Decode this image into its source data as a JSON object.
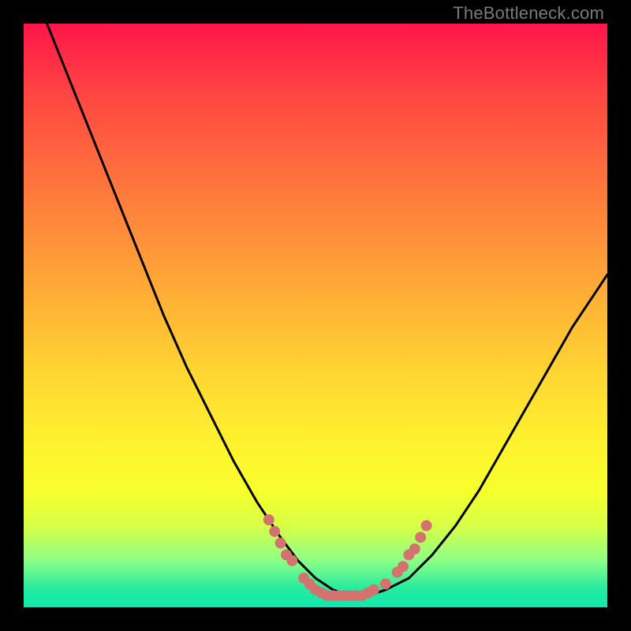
{
  "watermark": "TheBottleneck.com",
  "colors": {
    "frame": "#000000",
    "gradient_top": "#ff154a",
    "gradient_bottom": "#12e8b0",
    "curve": "#000000",
    "markers": "#d4726f"
  },
  "chart_data": {
    "type": "line",
    "title": "",
    "xlabel": "",
    "ylabel": "",
    "xlim": [
      0,
      100
    ],
    "ylim": [
      0,
      100
    ],
    "series": [
      {
        "name": "bottleneck-curve",
        "x": [
          4,
          8,
          12,
          16,
          20,
          24,
          28,
          32,
          36,
          40,
          44,
          47,
          50,
          53,
          56,
          59,
          62,
          66,
          70,
          74,
          78,
          82,
          86,
          90,
          94,
          98,
          100
        ],
        "y": [
          100,
          90,
          80,
          70,
          60,
          50,
          41,
          33,
          25,
          18,
          12,
          8,
          5,
          3,
          2,
          2,
          3,
          5,
          9,
          14,
          20,
          27,
          34,
          41,
          48,
          54,
          57
        ]
      }
    ],
    "markers": [
      {
        "x": 42,
        "y": 15
      },
      {
        "x": 43,
        "y": 13
      },
      {
        "x": 44,
        "y": 11
      },
      {
        "x": 45,
        "y": 9
      },
      {
        "x": 46,
        "y": 8
      },
      {
        "x": 48,
        "y": 5
      },
      {
        "x": 49,
        "y": 4
      },
      {
        "x": 50,
        "y": 3
      },
      {
        "x": 51,
        "y": 2.5
      },
      {
        "x": 52,
        "y": 2
      },
      {
        "x": 53,
        "y": 2
      },
      {
        "x": 54,
        "y": 2
      },
      {
        "x": 55,
        "y": 2
      },
      {
        "x": 56,
        "y": 2
      },
      {
        "x": 57,
        "y": 2
      },
      {
        "x": 58,
        "y": 2
      },
      {
        "x": 59,
        "y": 2.5
      },
      {
        "x": 60,
        "y": 3
      },
      {
        "x": 62,
        "y": 4
      },
      {
        "x": 64,
        "y": 6
      },
      {
        "x": 65,
        "y": 7
      },
      {
        "x": 66,
        "y": 9
      },
      {
        "x": 67,
        "y": 10
      },
      {
        "x": 68,
        "y": 12
      },
      {
        "x": 69,
        "y": 14
      }
    ]
  }
}
